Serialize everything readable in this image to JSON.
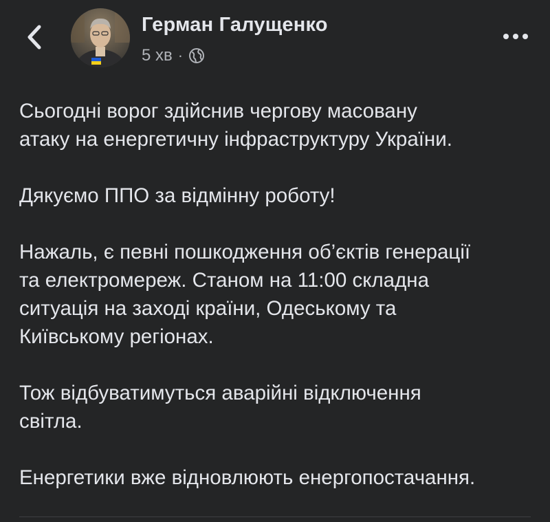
{
  "header": {
    "author_name": "Герман Галущенко",
    "time_ago": "5 хв",
    "separator": "·",
    "back_icon": "chevron-left-icon",
    "privacy_icon": "globe-icon",
    "more_icon": "more-horizontal-icon"
  },
  "post": {
    "paragraphs": [
      "Сьогодні ворог здійснив чергову масовану\nатаку на енергетичну інфраструктуру України.",
      "Дякуємо ППО за відмінну роботу!",
      "Нажаль, є певні пошкодження об’єктів генерації\nта електромереж. Станом на 11:00 складна\nситуація на заході країни, Одеському та\nКиївському регіонах.",
      "Тож відбуватимуться аварійні відключення\nсвітла.",
      "Енергетики вже відновлюють енергопостачання."
    ]
  },
  "colors": {
    "background": "#242526",
    "text_primary": "#e4e6eb",
    "text_secondary": "#b0b3b8"
  }
}
